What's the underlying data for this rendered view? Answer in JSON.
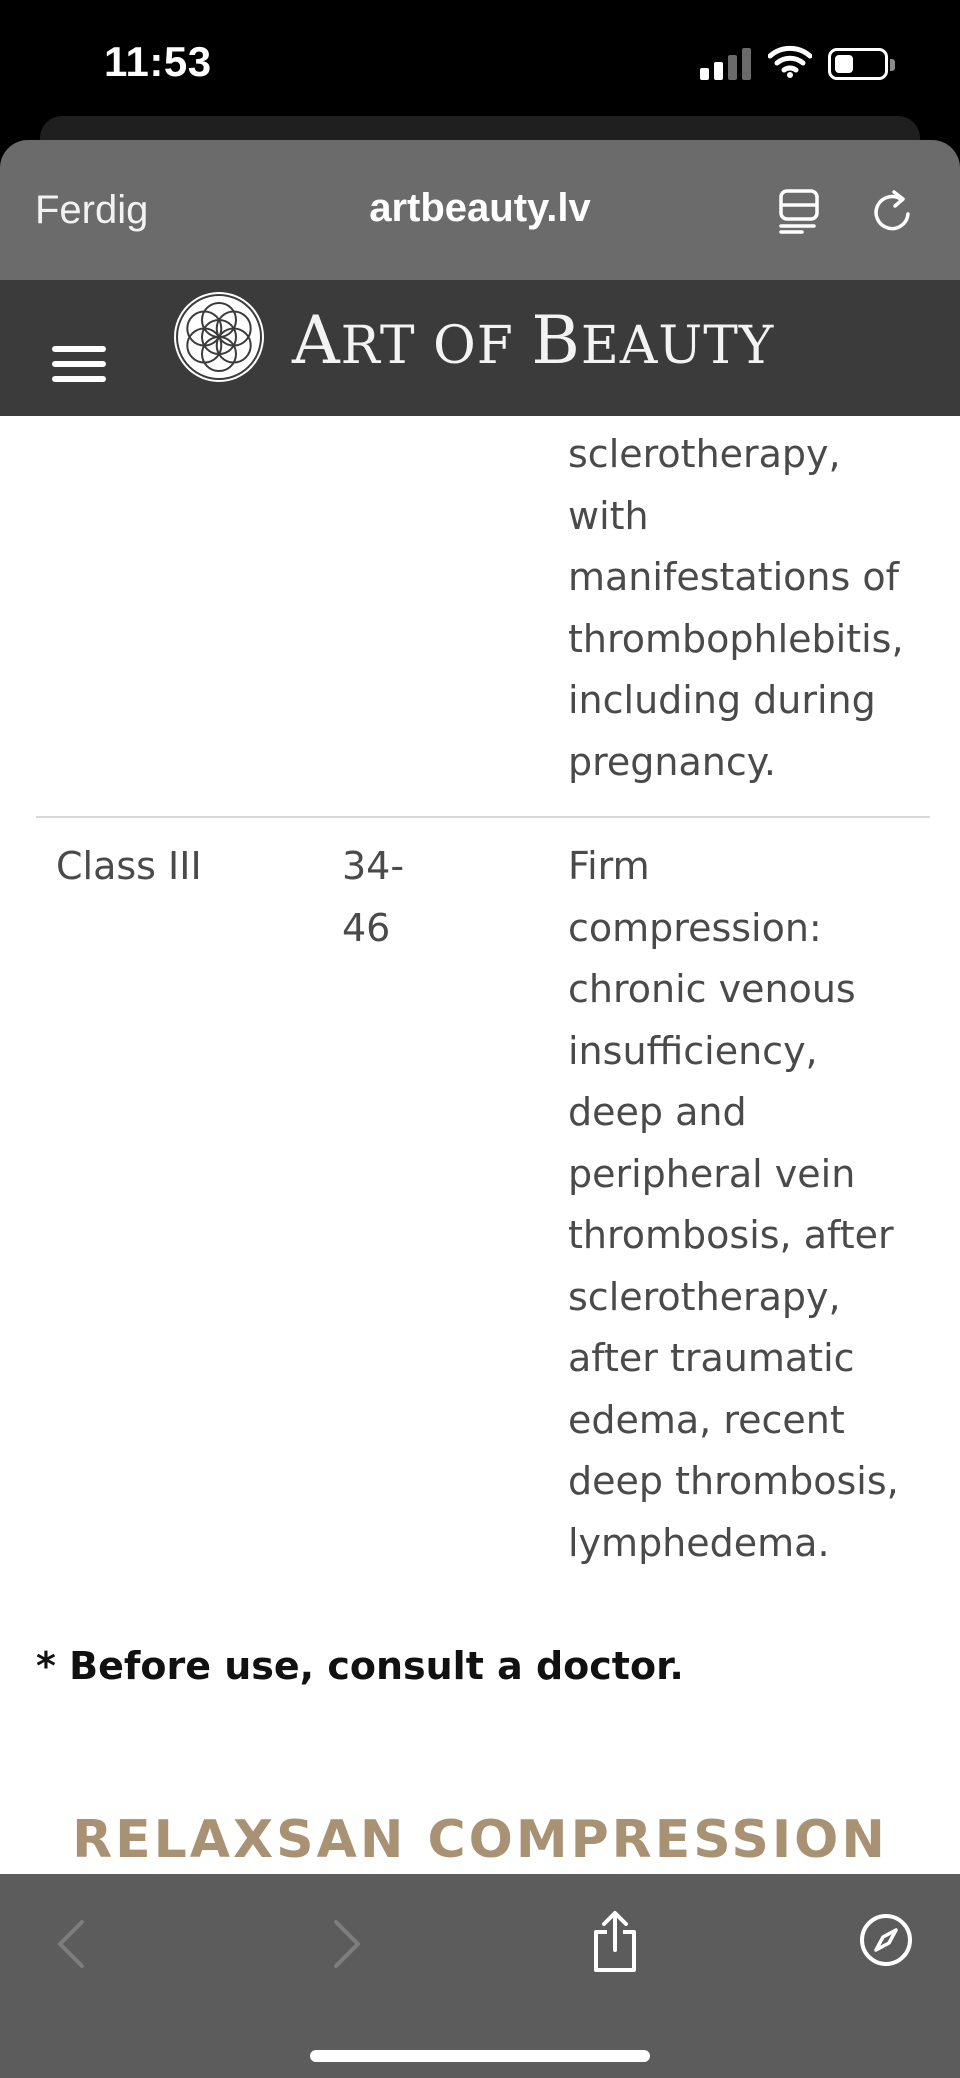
{
  "status_bar": {
    "time": "11:53",
    "signal_bars": 2,
    "battery_level": 0.25
  },
  "browser": {
    "done_label": "Ferdig",
    "url": "artbeauty.lv",
    "icons": [
      "reader-icon",
      "reload-icon",
      "back-icon",
      "forward-icon",
      "share-icon",
      "compass-icon"
    ]
  },
  "site": {
    "logo_text_first": "A",
    "logo_text_rest": "RT OF ",
    "logo_text_b": "B",
    "logo_text_end": "EAUTY",
    "accent_color": "#a89273",
    "header_color": "#3b3b3b"
  },
  "table": {
    "prev_row_description": "sclerotherapy,\nwith\nmanifestations of\nthrombophlebitis,\nincluding during\npregnancy.",
    "row": {
      "class": "Class III",
      "range": "34-\n46",
      "description": "Firm\ncompression:\nchronic venous\ninsufficiency,\ndeep and\nperipheral vein\nthrombosis, after\nsclerotherapy,\nafter traumatic\nedema, recent\ndeep thrombosis,\nlymphedema."
    }
  },
  "note": "* Before use, consult a doctor.",
  "section_title": "RELAXSAN COMPRESSION"
}
